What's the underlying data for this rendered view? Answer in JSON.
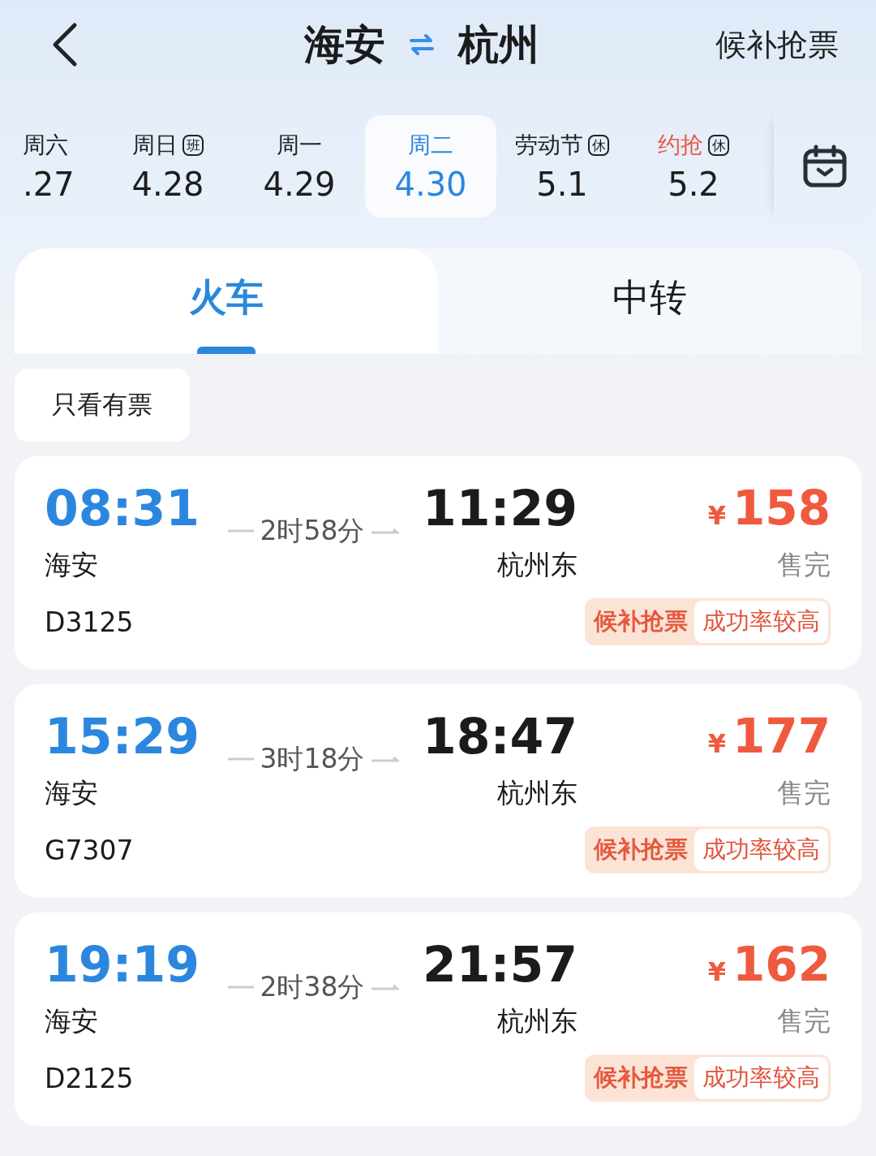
{
  "header": {
    "from": "海安",
    "to": "杭州",
    "action": "候补抢票"
  },
  "dates": [
    {
      "weekday": "周六",
      "date": ".27",
      "selected": false,
      "accent": false
    },
    {
      "weekday": "周日",
      "date": "4.28",
      "badge": "班",
      "selected": false,
      "accent": false
    },
    {
      "weekday": "周一",
      "date": "4.29",
      "selected": false,
      "accent": false
    },
    {
      "weekday": "周二",
      "date": "4.30",
      "selected": true,
      "accent": false
    },
    {
      "weekday": "劳动节",
      "date": "5.1",
      "badge": "休",
      "selected": false,
      "accent": false
    },
    {
      "weekday": "约抢",
      "date": "5.2",
      "badge": "休",
      "selected": false,
      "accent": true
    }
  ],
  "tabs": [
    {
      "label": "火车",
      "selected": true
    },
    {
      "label": "中转",
      "selected": false
    }
  ],
  "filter": {
    "label": "只看有票"
  },
  "trains": [
    {
      "depart": "08:31",
      "from": "海安",
      "number": "D3125",
      "duration": "2时58分",
      "arrive": "11:29",
      "to": "杭州东",
      "currency": "¥",
      "price": "158",
      "status": "售完",
      "tag": "候补抢票",
      "tag_note": "成功率较高"
    },
    {
      "depart": "15:29",
      "from": "海安",
      "number": "G7307",
      "duration": "3时18分",
      "arrive": "18:47",
      "to": "杭州东",
      "currency": "¥",
      "price": "177",
      "status": "售完",
      "tag": "候补抢票",
      "tag_note": "成功率较高"
    },
    {
      "depart": "19:19",
      "from": "海安",
      "number": "D2125",
      "duration": "2时38分",
      "arrive": "21:57",
      "to": "杭州东",
      "currency": "¥",
      "price": "162",
      "status": "售完",
      "tag": "候补抢票",
      "tag_note": "成功率较高"
    }
  ]
}
